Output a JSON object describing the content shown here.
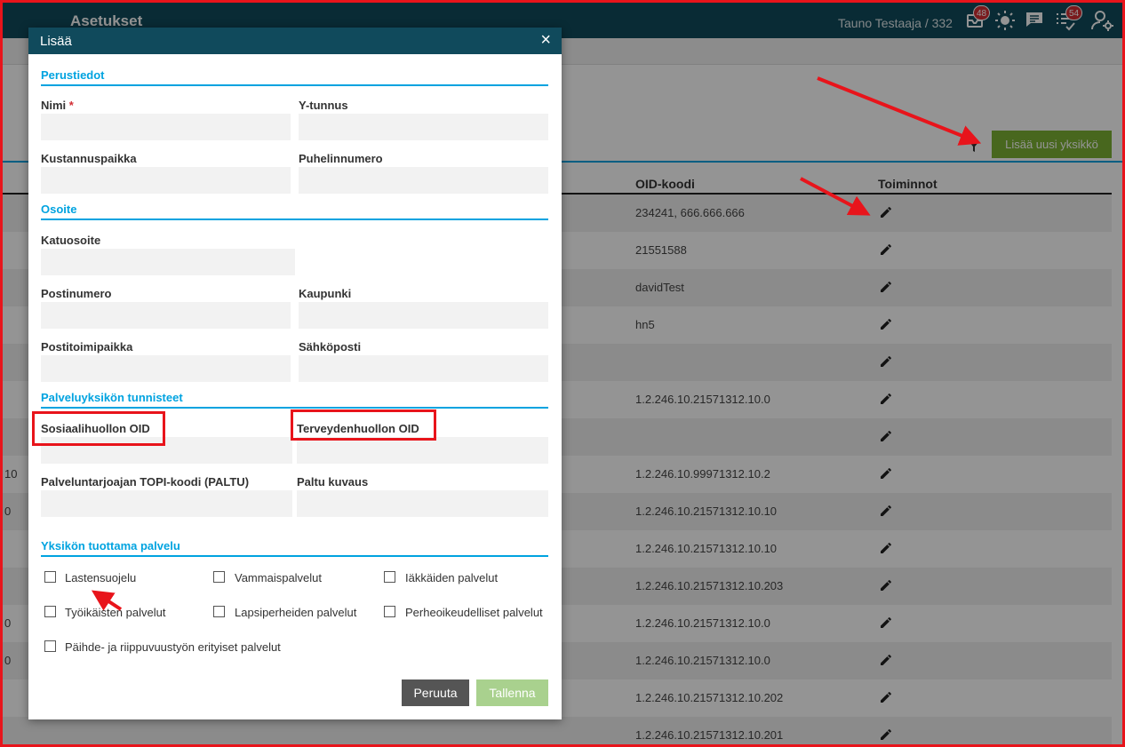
{
  "app": {
    "title": "Asetukset",
    "user": "Tauno Testaaja / 332"
  },
  "topbar_icons": [
    {
      "icon": "inbox-icon",
      "badge": "48"
    },
    {
      "icon": "sun-icon",
      "badge": ""
    },
    {
      "icon": "chat-icon",
      "badge": ""
    },
    {
      "icon": "checklist-icon",
      "badge": "54"
    },
    {
      "icon": "user-settings-icon",
      "badge": ""
    }
  ],
  "page": {
    "add_unit_button": "Lisää uusi yksikkö"
  },
  "table": {
    "headers": {
      "oid": "OID-koodi",
      "actions": "Toiminnot"
    },
    "rows": [
      {
        "left": "",
        "oid": "234241, 666.666.666"
      },
      {
        "left": "",
        "oid": "21551588"
      },
      {
        "left": "",
        "oid": "davidTest"
      },
      {
        "left": "",
        "oid": "hn5"
      },
      {
        "left": "",
        "oid": ""
      },
      {
        "left": "",
        "oid": "1.2.246.10.21571312.10.0"
      },
      {
        "left": "",
        "oid": ""
      },
      {
        "left": "10",
        "oid": "1.2.246.10.99971312.10.2"
      },
      {
        "left": "0",
        "oid": "1.2.246.10.21571312.10.10"
      },
      {
        "left": "",
        "oid": "1.2.246.10.21571312.10.10"
      },
      {
        "left": "",
        "oid": "1.2.246.10.21571312.10.203"
      },
      {
        "left": "0",
        "oid": "1.2.246.10.21571312.10.0"
      },
      {
        "left": "0",
        "oid": "1.2.246.10.21571312.10.0"
      },
      {
        "left": "",
        "oid": "1.2.246.10.21571312.10.202"
      },
      {
        "left": "",
        "oid": "1.2.246.10.21571312.10.201"
      }
    ]
  },
  "modal": {
    "title": "Lisää",
    "close": "×",
    "sections": {
      "basic": "Perustiedot",
      "address": "Osoite",
      "identifiers": "Palveluyksikön tunnisteet",
      "services": "Yksikön tuottama palvelu"
    },
    "fields": {
      "name": "Nimi",
      "required_mark": "*",
      "business_id": "Y-tunnus",
      "cost_center": "Kustannuspaikka",
      "phone": "Puhelinnumero",
      "street": "Katuosoite",
      "postal_code": "Postinumero",
      "city": "Kaupunki",
      "post_office": "Postitoimipaikka",
      "email": "Sähköposti",
      "social_oid": "Sosiaalihuollon OID",
      "health_oid": "Terveydenhuollon OID",
      "topi_code": "Palveluntarjoajan TOPI-koodi (PALTU)",
      "paltu_desc": "Paltu kuvaus"
    },
    "services": [
      "Lastensuojelu",
      "Vammaispalvelut",
      "Iäkkäiden palvelut",
      "Työikäisten palvelut",
      "Lapsiperheiden palvelut",
      "Perheoikeudelliset palvelut",
      "Päihde- ja riippuvuustyön erityiset palvelut"
    ],
    "buttons": {
      "cancel": "Peruuta",
      "save": "Tallenna"
    }
  }
}
